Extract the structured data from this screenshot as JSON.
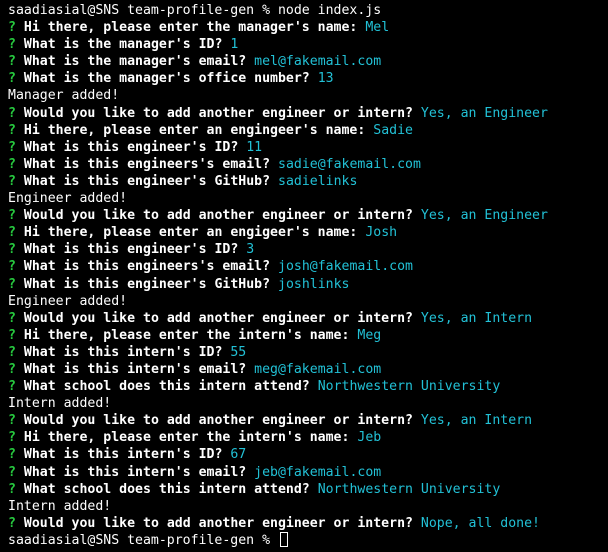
{
  "shell": {
    "start_command": "saadiasial@SNS team-profile-gen % node index.js",
    "end_prompt": "saadiasial@SNS team-profile-gen % "
  },
  "prompt_marker": "?",
  "lines": [
    {
      "type": "shell",
      "text": "saadiasial@SNS team-profile-gen % node index.js"
    },
    {
      "type": "qa",
      "q": "Hi there, please enter the manager's name:",
      "a": "Mel"
    },
    {
      "type": "qa",
      "q": "What is the manager's ID?",
      "a": "1"
    },
    {
      "type": "qa",
      "q": "What is the manager's email?",
      "a": "mel@fakemail.com"
    },
    {
      "type": "qa",
      "q": "What is the manager's office number?",
      "a": "13"
    },
    {
      "type": "info",
      "text": "Manager added!"
    },
    {
      "type": "qa",
      "q": "Would you like to add another engineer or intern?",
      "a": "Yes, an Engineer"
    },
    {
      "type": "qa",
      "q": "Hi there, please enter an engingeer's name:",
      "a": "Sadie"
    },
    {
      "type": "qa",
      "q": "What is this engineer's ID?",
      "a": "11"
    },
    {
      "type": "qa",
      "q": "What is this engineers's email?",
      "a": "sadie@fakemail.com"
    },
    {
      "type": "qa",
      "q": "What is this engineer's GitHub?",
      "a": "sadielinks"
    },
    {
      "type": "info",
      "text": "Engineer added!"
    },
    {
      "type": "qa",
      "q": "Would you like to add another engineer or intern?",
      "a": "Yes, an Engineer"
    },
    {
      "type": "qa",
      "q": "Hi there, please enter an engigeer's name:",
      "a": "Josh"
    },
    {
      "type": "qa",
      "q": "What is this engineer's ID?",
      "a": "3"
    },
    {
      "type": "qa",
      "q": "What is this engineers's email?",
      "a": "josh@fakemail.com"
    },
    {
      "type": "qa",
      "q": "What is this engineer's GitHub?",
      "a": "joshlinks"
    },
    {
      "type": "info",
      "text": "Engineer added!"
    },
    {
      "type": "qa",
      "q": "Would you like to add another engineer or intern?",
      "a": "Yes, an Intern"
    },
    {
      "type": "qa",
      "q": "Hi there, please enter the intern's name:",
      "a": "Meg"
    },
    {
      "type": "qa",
      "q": "What is this intern's ID?",
      "a": "55"
    },
    {
      "type": "qa",
      "q": "What is this intern's email?",
      "a": "meg@fakemail.com"
    },
    {
      "type": "qa",
      "q": "What school does this intern attend?",
      "a": "Northwestern University"
    },
    {
      "type": "info",
      "text": "Intern added!"
    },
    {
      "type": "qa",
      "q": "Would you like to add another engineer or intern?",
      "a": "Yes, an Intern"
    },
    {
      "type": "qa",
      "q": "Hi there, please enter the intern's name:",
      "a": "Jeb"
    },
    {
      "type": "qa",
      "q": "What is this intern's ID?",
      "a": "67"
    },
    {
      "type": "qa",
      "q": "What is this intern's email?",
      "a": "jeb@fakemail.com"
    },
    {
      "type": "qa",
      "q": "What school does this intern attend?",
      "a": "Northwestern University"
    },
    {
      "type": "info",
      "text": "Intern added!"
    },
    {
      "type": "qa",
      "q": "Would you like to add another engineer or intern?",
      "a": "Nope, all done!"
    },
    {
      "type": "end_prompt",
      "text": "saadiasial@SNS team-profile-gen % "
    }
  ],
  "colors": {
    "background": "#000000",
    "text": "#ffffff",
    "prompt_marker": "#27c93f",
    "answer": "#22c1d6"
  }
}
